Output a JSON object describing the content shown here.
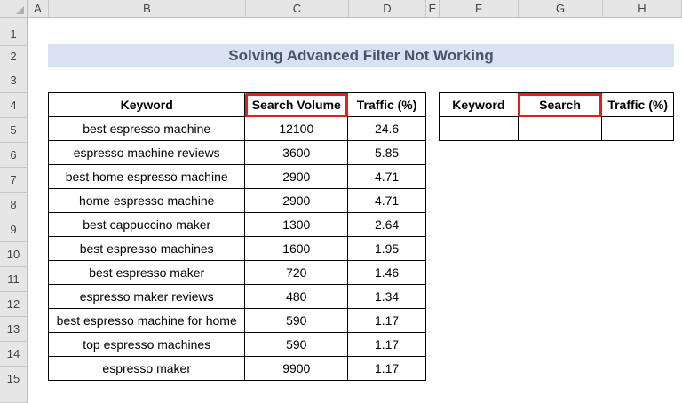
{
  "spreadsheet": {
    "columns": [
      "A",
      "B",
      "C",
      "D",
      "E",
      "F",
      "G",
      "H"
    ],
    "rows": [
      "1",
      "2",
      "3",
      "4",
      "5",
      "6",
      "7",
      "8",
      "9",
      "10",
      "11",
      "12",
      "13",
      "14",
      "15"
    ],
    "title": "Solving Advanced Filter Not Working"
  },
  "data_table": {
    "headers": [
      "Keyword",
      "Search Volume",
      "Traffic (%)"
    ],
    "rows": [
      [
        "best espresso machine",
        "12100",
        "24.6"
      ],
      [
        "espresso machine reviews",
        "3600",
        "5.85"
      ],
      [
        "best home espresso machine",
        "2900",
        "4.71"
      ],
      [
        "home espresso machine",
        "2900",
        "4.71"
      ],
      [
        "best cappuccino maker",
        "1300",
        "2.64"
      ],
      [
        "best espresso machines",
        "1600",
        "1.95"
      ],
      [
        "best espresso maker",
        "720",
        "1.46"
      ],
      [
        "espresso maker reviews",
        "480",
        "1.34"
      ],
      [
        "best espresso machine for home",
        "590",
        "1.17"
      ],
      [
        "top espresso machines",
        "590",
        "1.17"
      ],
      [
        "espresso maker",
        "9900",
        "1.17"
      ]
    ]
  },
  "criteria_table": {
    "headers": [
      "Keyword",
      "Search",
      "Traffic (%)"
    ],
    "values": [
      "",
      "",
      ""
    ]
  },
  "colors": {
    "title_fill": "#d9e1f2",
    "title_text": "#44546a",
    "highlight": "#e32020"
  }
}
